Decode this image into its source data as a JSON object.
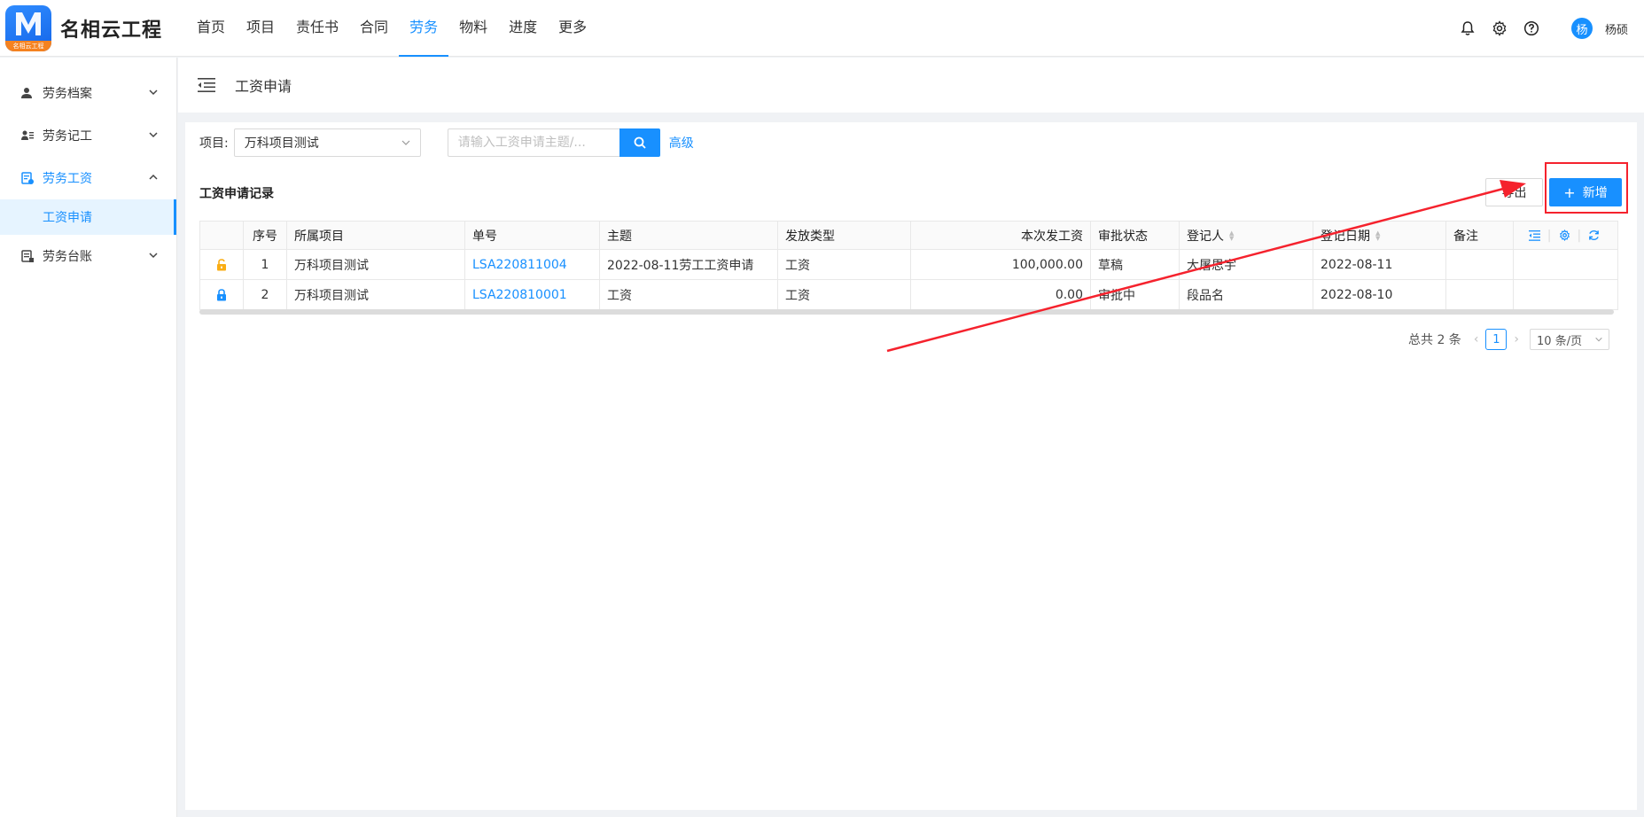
{
  "app": {
    "name": "名相云工程",
    "logo_strip": "名相云工程"
  },
  "nav": {
    "items": [
      "首页",
      "项目",
      "责任书",
      "合同",
      "劳务",
      "物料",
      "进度",
      "更多"
    ],
    "active_index": 4
  },
  "user": {
    "avatar_text": "杨",
    "name": "杨硕"
  },
  "sidebar": {
    "items": [
      {
        "label": "劳务档案",
        "expanded": false
      },
      {
        "label": "劳务记工",
        "expanded": false
      },
      {
        "label": "劳务工资",
        "expanded": true,
        "children": [
          "工资申请"
        ]
      },
      {
        "label": "劳务台账",
        "expanded": false
      }
    ]
  },
  "page": {
    "title": "工资申请"
  },
  "filter": {
    "project_label": "项目:",
    "project_value": "万科项目测试",
    "search_placeholder": "请输入工资申请主题/...",
    "advanced_label": "高级"
  },
  "section": {
    "title": "工资申请记录"
  },
  "toolbar": {
    "export_label": "导出",
    "add_label": "新增"
  },
  "table": {
    "columns": [
      "序号",
      "所属项目",
      "单号",
      "主题",
      "发放类型",
      "本次发工资",
      "审批状态",
      "登记人",
      "登记日期",
      "备注"
    ],
    "rows": [
      {
        "lock": "unlocked",
        "no": "1",
        "project": "万科项目测试",
        "code": "LSA220811004",
        "subject": "2022-08-11劳工工资申请",
        "type": "工资",
        "amount": "100,000.00",
        "status": "草稿",
        "registrar": "大屠思宇",
        "date": "2022-08-11",
        "note": ""
      },
      {
        "lock": "locked",
        "no": "2",
        "project": "万科项目测试",
        "code": "LSA220810001",
        "subject": "工资",
        "type": "工资",
        "amount": "0.00",
        "status": "审批中",
        "registrar": "段品名",
        "date": "2022-08-10",
        "note": ""
      }
    ]
  },
  "pagination": {
    "total_text": "总共 2 条",
    "current_page": "1",
    "page_size": "10 条/页"
  },
  "colors": {
    "primary": "#1890ff",
    "unlocked": "#faad14",
    "annotation": "#f5222d"
  }
}
